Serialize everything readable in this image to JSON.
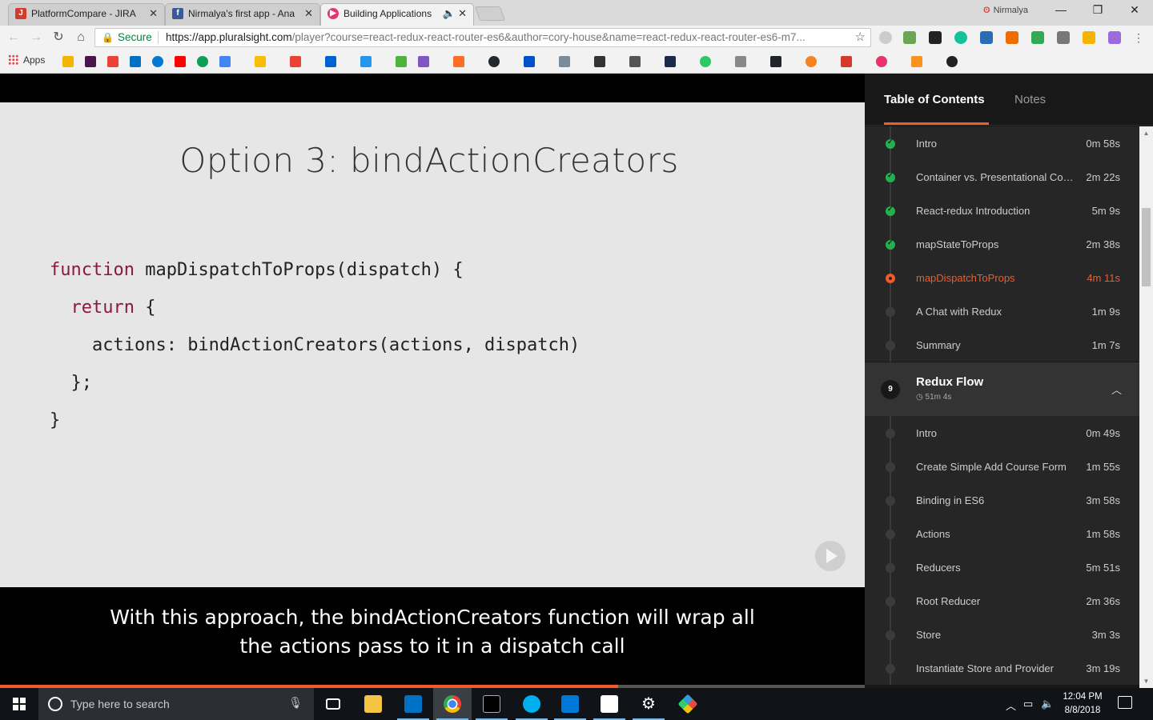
{
  "browser": {
    "tabs": [
      {
        "title": "PlatformCompare - JIRA",
        "icon": "jira-icon",
        "color": "#d33a2c"
      },
      {
        "title": "Nirmalya's first app - Ana",
        "icon": "facebook-icon",
        "color": "#3b5998"
      },
      {
        "title": "Building Applications",
        "icon": "pluralsight-icon",
        "color": "#e8336b"
      }
    ],
    "user": "Nirmalya",
    "secure_label": "Secure",
    "url_host": "https://app.pluralsight.com",
    "url_path": "/player?course=react-redux-react-router-es6&author=cory-house&name=react-redux-react-router-es6-m7...",
    "apps_label": "Apps"
  },
  "slide": {
    "title": "Option 3: bindActionCreators",
    "code": {
      "l1_kw": "function",
      "l1_rest": " mapDispatchToProps(dispatch) {",
      "l2_kw": "return",
      "l2_rest": " {",
      "l3": "actions: bindActionCreators(actions, dispatch)",
      "l4": "};",
      "l5": "}"
    }
  },
  "caption": {
    "line1": "With this approach, the bindActionCreators function will wrap all",
    "line2": "the actions pass to it in a dispatch call"
  },
  "player": {
    "progress_fraction": 0.715,
    "accent": "#f15b2a"
  },
  "sidebar": {
    "tabs": {
      "toc": "Table of Contents",
      "notes": "Notes"
    },
    "clips_prev": [
      {
        "title": "Intro",
        "duration": "0m 58s",
        "state": "done"
      },
      {
        "title": "Container vs. Presentational Components",
        "duration": "2m 22s",
        "state": "done"
      },
      {
        "title": "React-redux Introduction",
        "duration": "5m 9s",
        "state": "done"
      },
      {
        "title": "mapStateToProps",
        "duration": "2m 38s",
        "state": "done"
      },
      {
        "title": "mapDispatchToProps",
        "duration": "4m 11s",
        "state": "current"
      },
      {
        "title": "A Chat with Redux",
        "duration": "1m 9s",
        "state": "todo"
      },
      {
        "title": "Summary",
        "duration": "1m 7s",
        "state": "todo"
      }
    ],
    "module": {
      "number": "9",
      "title": "Redux Flow",
      "duration": "51m 4s"
    },
    "clips_next": [
      {
        "title": "Intro",
        "duration": "0m 49s"
      },
      {
        "title": "Create Simple Add Course Form",
        "duration": "1m 55s"
      },
      {
        "title": "Binding in ES6",
        "duration": "3m 58s"
      },
      {
        "title": "Actions",
        "duration": "1m 58s"
      },
      {
        "title": "Reducers",
        "duration": "5m 51s"
      },
      {
        "title": "Root Reducer",
        "duration": "2m 36s"
      },
      {
        "title": "Store",
        "duration": "3m 3s"
      },
      {
        "title": "Instantiate Store and Provider",
        "duration": "3m 19s"
      }
    ]
  },
  "taskbar": {
    "search_placeholder": "Type here to search",
    "time": "12:04 PM",
    "date": "8/8/2018"
  }
}
